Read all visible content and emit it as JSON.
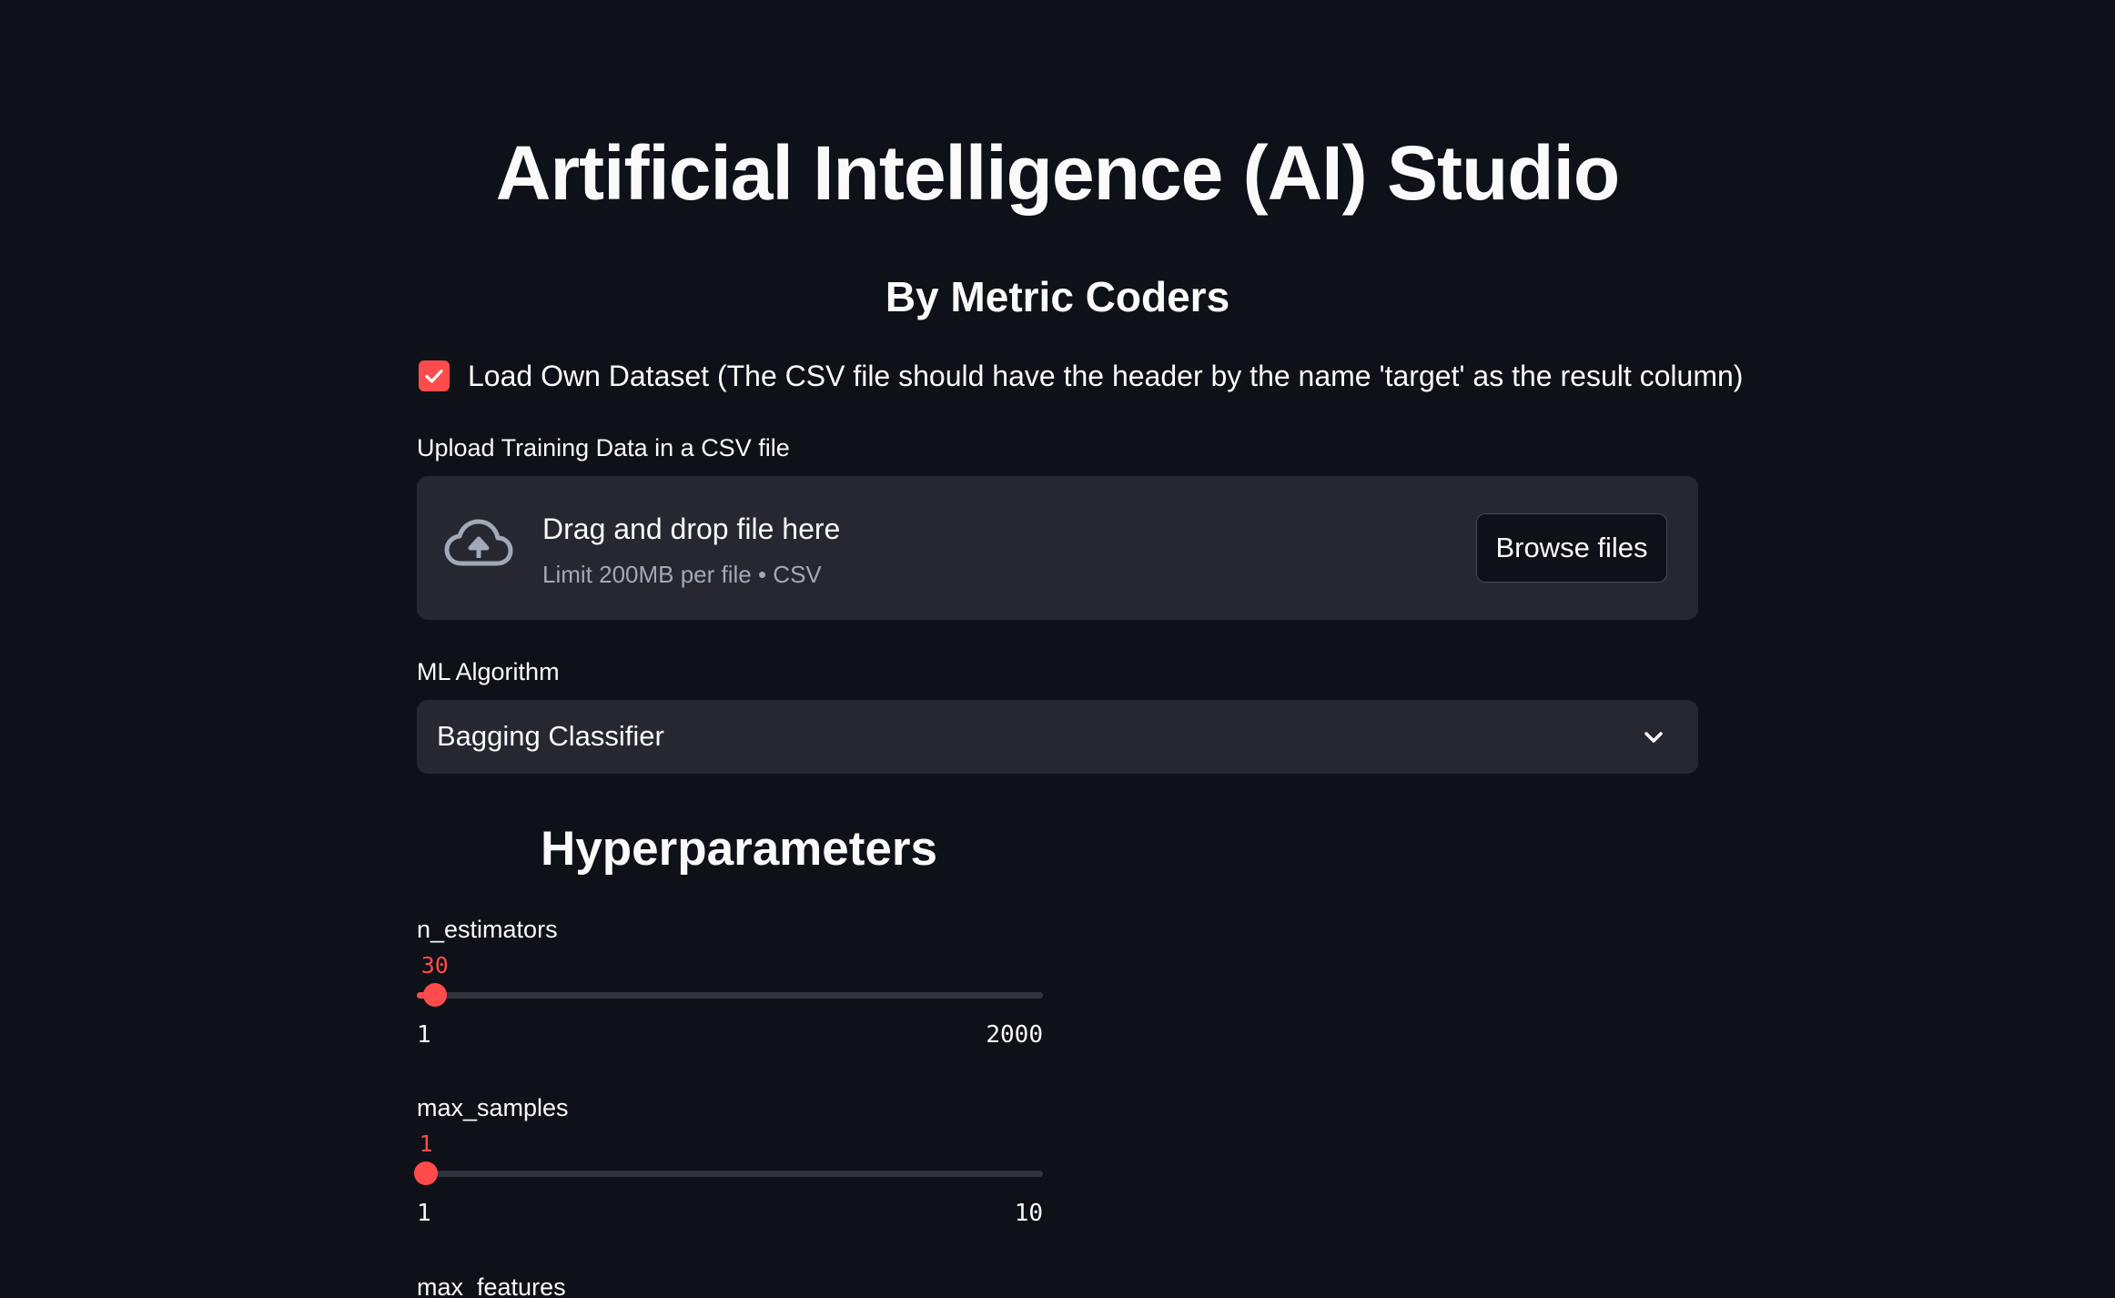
{
  "header": {
    "title": "Artificial Intelligence (AI) Studio",
    "subtitle": "By Metric Coders"
  },
  "load_dataset": {
    "checked": true,
    "label": "Load Own Dataset (The CSV file should have the header by the name 'target' as the result column)"
  },
  "uploader": {
    "label": "Upload Training Data in a CSV file",
    "drop_text": "Drag and drop file here",
    "limit_text": "Limit 200MB per file • CSV",
    "browse_label": "Browse files",
    "icon": "cloud-upload-icon"
  },
  "algorithm": {
    "label": "ML Algorithm",
    "selected": "Bagging Classifier"
  },
  "hyperparameters": {
    "title": "Hyperparameters",
    "sliders": [
      {
        "label": "n_estimators",
        "value": "30",
        "min": "1",
        "max": "2000",
        "value_num": 30,
        "min_num": 1,
        "max_num": 2000
      },
      {
        "label": "max_samples",
        "value": "1",
        "min": "1",
        "max": "10",
        "value_num": 1,
        "min_num": 1,
        "max_num": 10
      }
    ],
    "next_label": "max_features"
  },
  "colors": {
    "background": "#0e1117",
    "surface": "#262730",
    "accent": "#ff4b4b",
    "text": "#fafafa",
    "muted_text": "#a3a8b8"
  }
}
